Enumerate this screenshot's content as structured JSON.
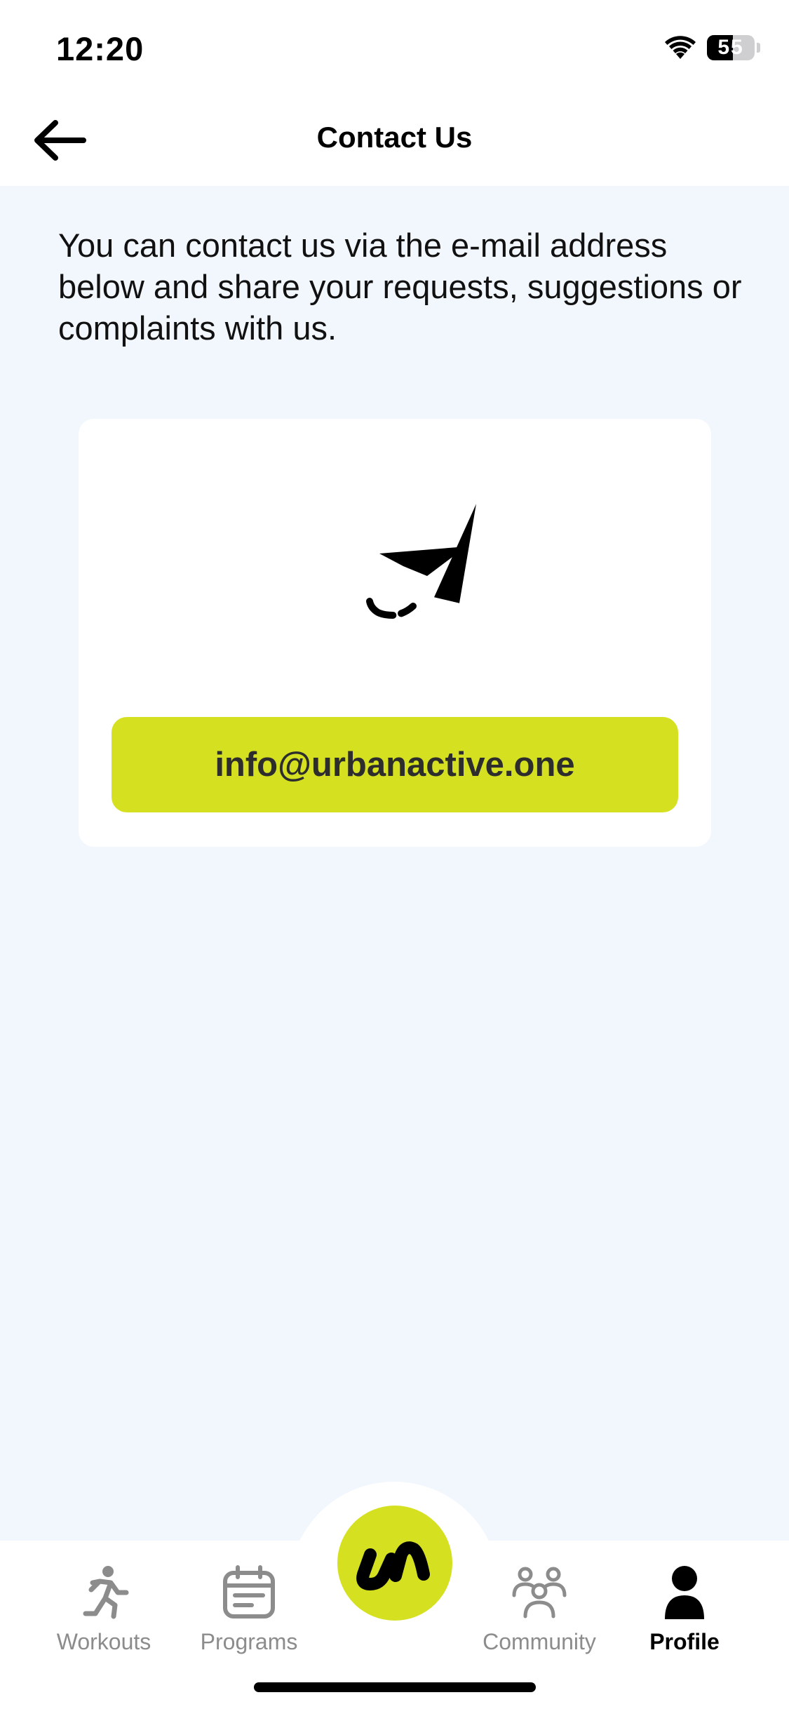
{
  "status_bar": {
    "time": "12:20",
    "battery": "55"
  },
  "header": {
    "title": "Contact Us"
  },
  "intro": {
    "text": "You can contact us via the e-mail address below and share your requests, suggestions or complaints with us."
  },
  "contact_card": {
    "icon": "paper-plane-icon",
    "email": "info@urbanactive.one"
  },
  "tab_bar": {
    "items": [
      {
        "label": "Workouts",
        "icon": "running-person-icon",
        "active": false
      },
      {
        "label": "Programs",
        "icon": "calendar-icon",
        "active": false
      },
      {
        "label": "Community",
        "icon": "people-group-icon",
        "active": false
      },
      {
        "label": "Profile",
        "icon": "person-icon",
        "active": true
      }
    ],
    "center": {
      "icon": "urbanactive-logo-icon"
    }
  },
  "colors": {
    "accent": "#d5e021",
    "background": "#f2f7fd",
    "surface": "#ffffff"
  }
}
